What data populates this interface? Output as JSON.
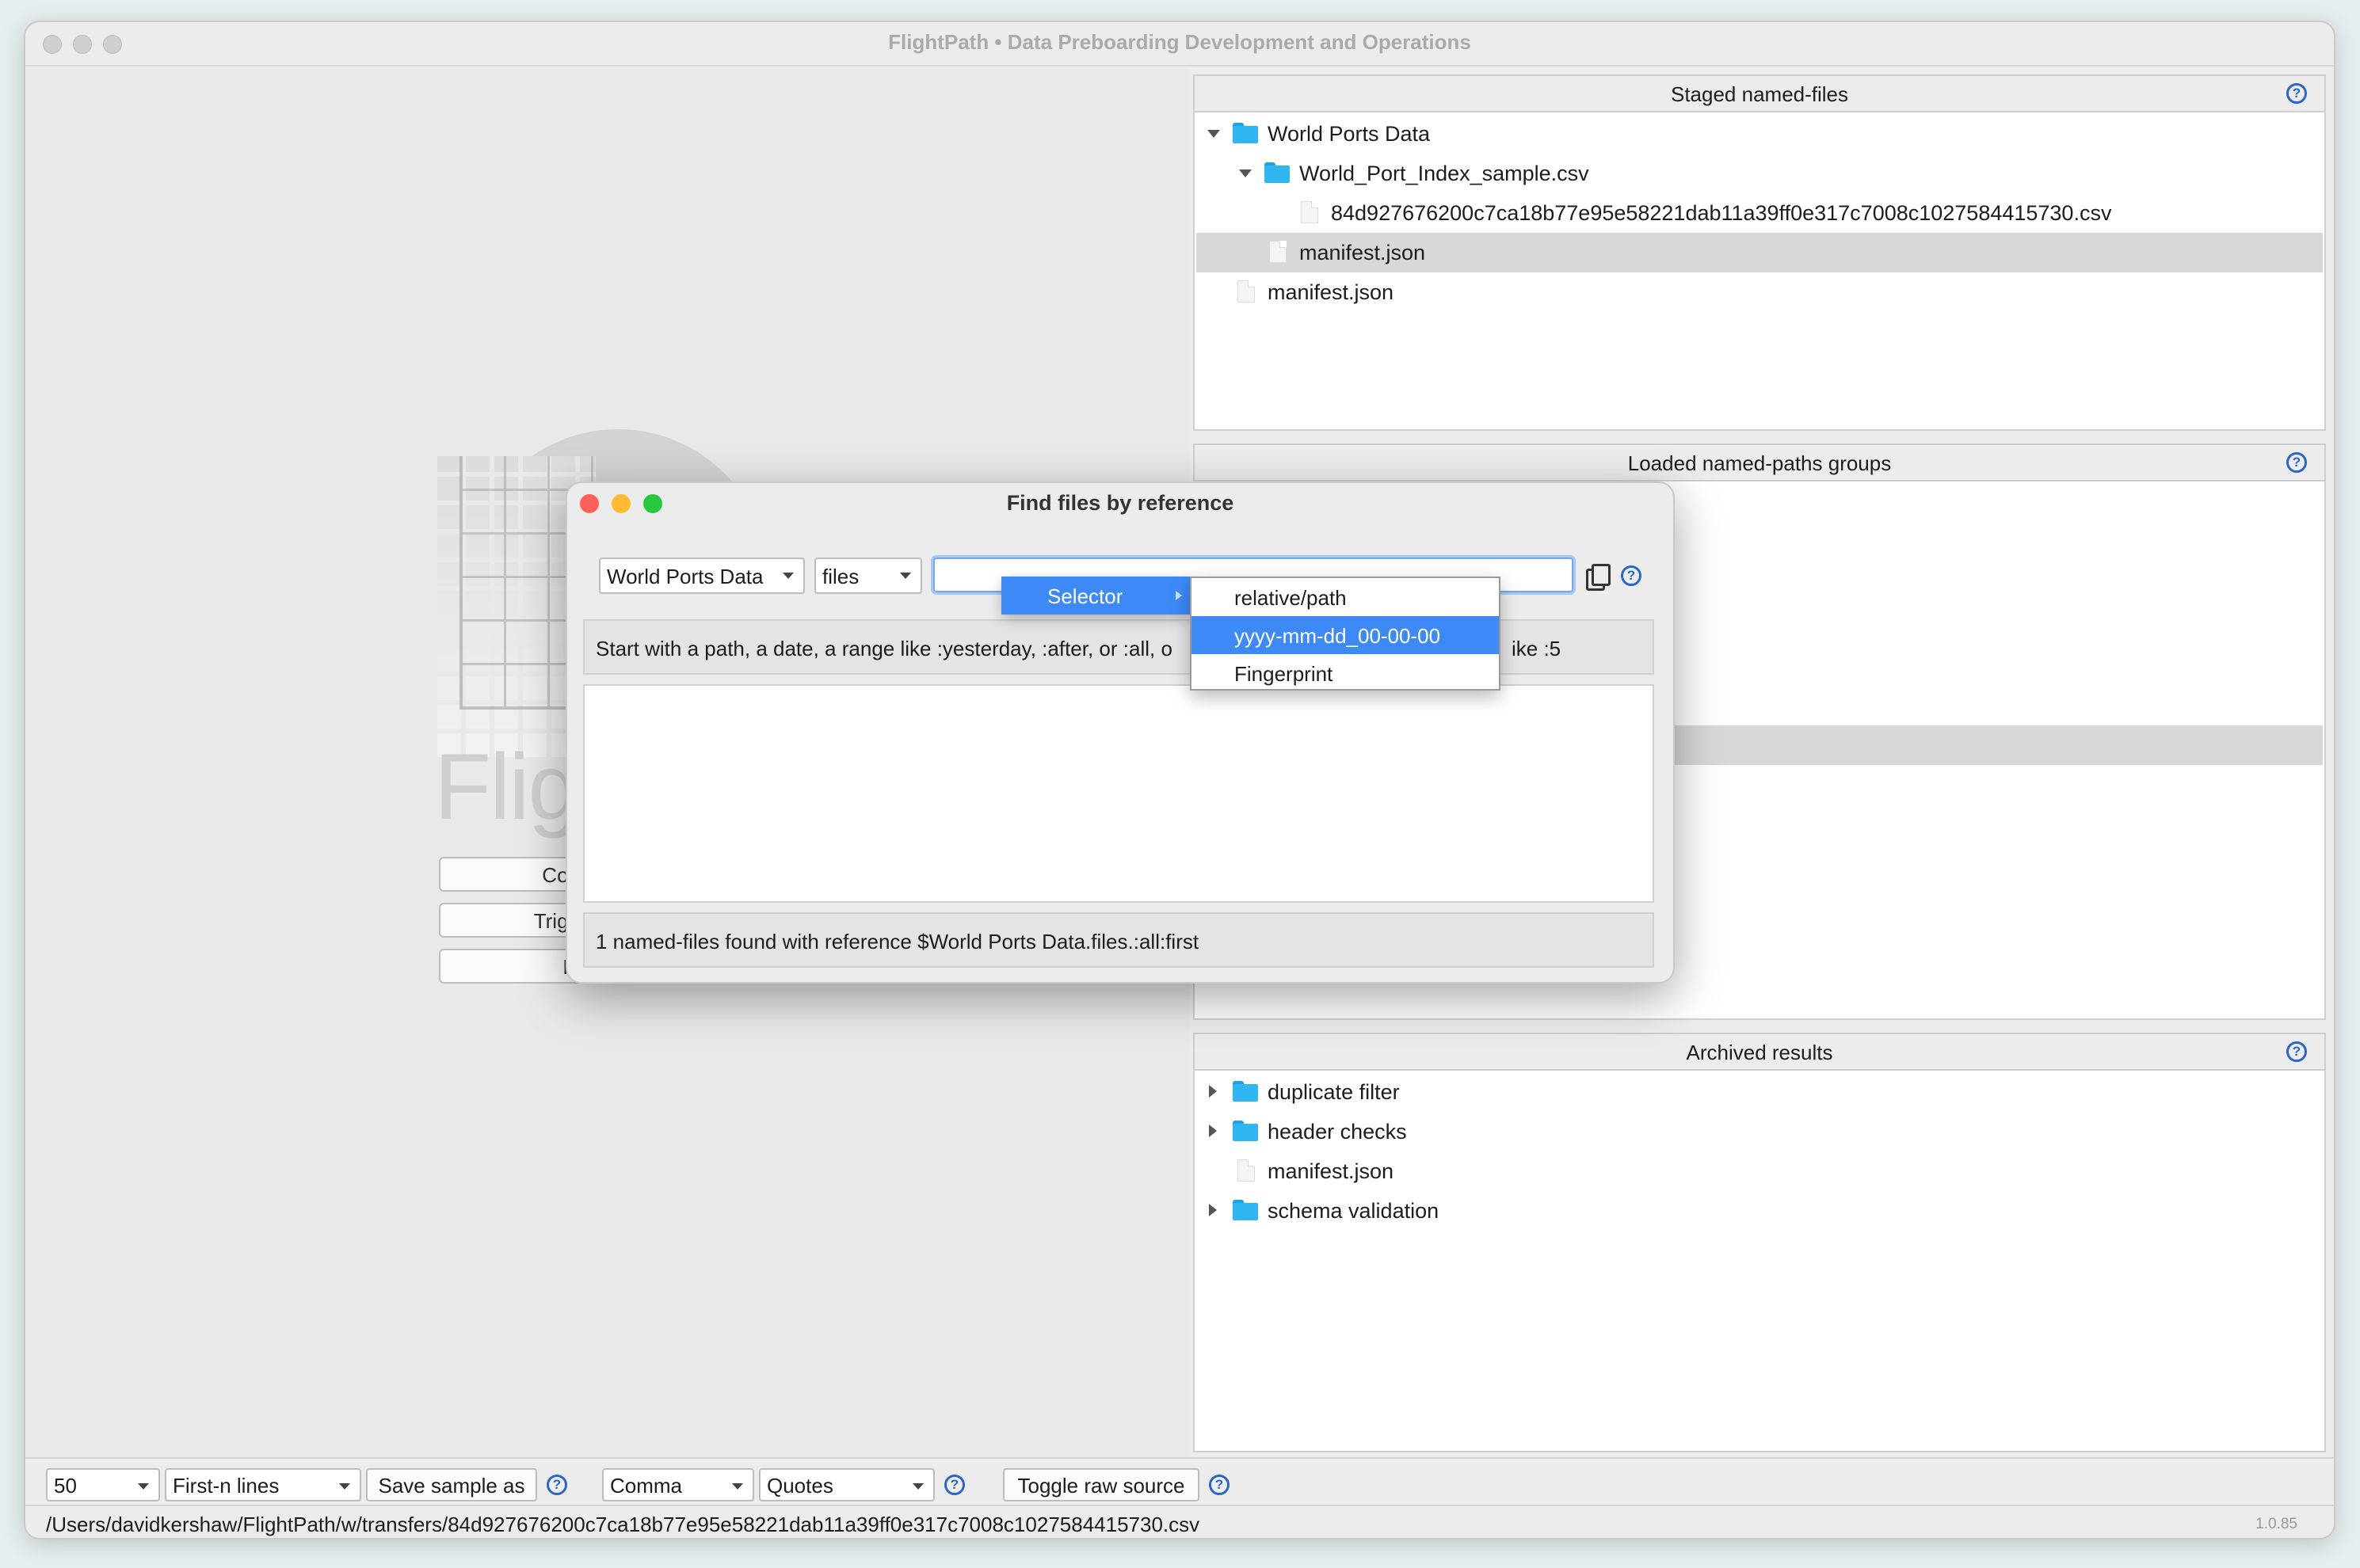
{
  "window": {
    "title": "FlightPath • Data Preboarding Development and Operations"
  },
  "left": {
    "logo_text": "Flig",
    "buttons": [
      "Cop",
      "Trigg",
      "Fi"
    ]
  },
  "staged": {
    "header": "Staged named-files",
    "rows": [
      {
        "label": "World Ports Data"
      },
      {
        "label": "World_Port_Index_sample.csv"
      },
      {
        "label": "84d927676200c7ca18b77e95e58221dab11a39ff0e317c7008c1027584415730.csv"
      },
      {
        "label": "manifest.json"
      },
      {
        "label": "manifest.json"
      }
    ]
  },
  "loaded": {
    "header": "Loaded named-paths groups"
  },
  "archived": {
    "header": "Archived results",
    "rows": [
      {
        "label": "duplicate filter"
      },
      {
        "label": "header checks"
      },
      {
        "label": "manifest.json"
      },
      {
        "label": "schema validation"
      }
    ]
  },
  "toolbar": {
    "sample_size": "50",
    "sample_mode": "First-n lines",
    "save_sample": "Save sample as",
    "delimiter": "Comma",
    "quotechar": "Quotes",
    "toggle_raw": "Toggle raw source"
  },
  "status": {
    "path": "/Users/davidkershaw/FlightPath/w/transfers/84d927676200c7ca18b77e95e58221dab11a39ff0e317c7008c1027584415730.csv",
    "version": "1.0.85"
  },
  "dialog": {
    "title": "Find files by reference",
    "named_file": "World Ports Data",
    "kind": "files",
    "reference_value": "",
    "hint": "Start with a path, a date, a range like :yesterday, :after, or :all, o",
    "hint_tail": "ike :5",
    "found": "1 named-files found with reference $World Ports Data.files.:all:first"
  },
  "menu": {
    "selector": "Selector",
    "items": [
      "relative/path",
      "yyyy-mm-dd_00-00-00",
      "Fingerprint"
    ]
  },
  "colors": {
    "accent": "#3d8af7",
    "folder": "#2fb6f2",
    "help": "#2a66c8"
  }
}
